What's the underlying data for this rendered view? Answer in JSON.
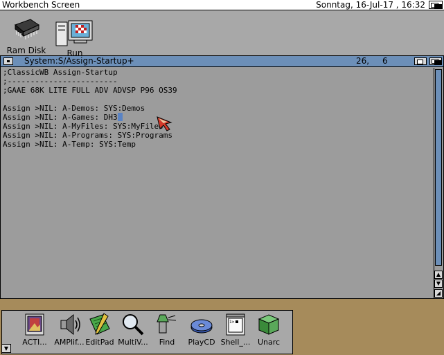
{
  "screen": {
    "title": "Workbench Screen",
    "clock": "Sonntag, 16-Jul-17 , 16:32"
  },
  "desktop_icons": [
    {
      "label": "Ram Disk",
      "icon": "ram-disk-icon"
    },
    {
      "label": "Run",
      "icon": "run-icon"
    }
  ],
  "window": {
    "title": "System:S/Assign-Startup+",
    "line": "26,",
    "column": "6",
    "accent_color": "#6c8fb8"
  },
  "editor": {
    "lines": [
      ";ClassicWB Assign-Startup",
      ";------------------------",
      ";GAAE 68K LITE FULL ADV ADVSP P96 OS39",
      "",
      "Assign >NIL: A-Demos: SYS:Demos",
      "Assign >NIL: A-Games: DH3",
      "Assign >NIL: A-MyFiles: SYS:MyFiles",
      "Assign >NIL: A-Programs: SYS:Programs",
      "Assign >NIL: A-Temp: SYS:Temp"
    ]
  },
  "dock": {
    "items": [
      {
        "label": "ACTI...",
        "icon": "acti-icon"
      },
      {
        "label": "AMPlif...",
        "icon": "speaker-icon"
      },
      {
        "label": "EditPad",
        "icon": "notepad-pencil-icon"
      },
      {
        "label": "MultiV...",
        "icon": "magnifier-icon"
      },
      {
        "label": "Find",
        "icon": "flashlight-icon"
      },
      {
        "label": "PlayCD",
        "icon": "cd-icon"
      },
      {
        "label": "Shell_...",
        "icon": "shell-window-icon"
      },
      {
        "label": "Unarc",
        "icon": "cube-icon"
      }
    ]
  }
}
